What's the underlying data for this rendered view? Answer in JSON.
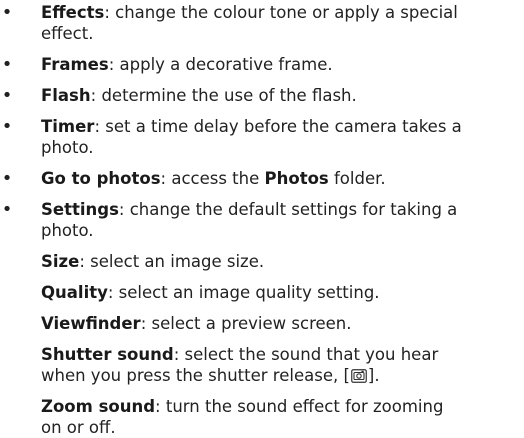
{
  "bullet_symbol": "•",
  "items": [
    {
      "term": "Effects",
      "desc": ": change the colour tone or apply a special",
      "cont": "effect."
    },
    {
      "term": "Frames",
      "desc": ": apply a decorative frame."
    },
    {
      "term": "Flash",
      "desc": ": determine the use of the flash."
    },
    {
      "term": "Timer",
      "desc": ": set a time delay before the camera takes a",
      "cont": "photo."
    },
    {
      "term": "Go to photos",
      "desc_a": ": access the ",
      "bold": "Photos",
      "desc_b": " folder."
    },
    {
      "term": "Settings",
      "desc": ": change the default settings for taking a",
      "cont": "photo."
    }
  ],
  "settings_sub": [
    {
      "term": "Size",
      "desc": ": select an image size."
    },
    {
      "term": "Quality",
      "desc": ": select an image quality setting."
    },
    {
      "term": "Viewfinder",
      "desc": ": select a preview screen."
    },
    {
      "term": "Shutter sound",
      "desc": ": select the sound that you hear",
      "cont_a": "when you press the shutter release, [",
      "cont_icon": "camera-shutter-icon",
      "cont_b": "]."
    },
    {
      "term": "Zoom sound",
      "desc": ": turn the sound effect for zooming",
      "cont": "on or off."
    }
  ]
}
